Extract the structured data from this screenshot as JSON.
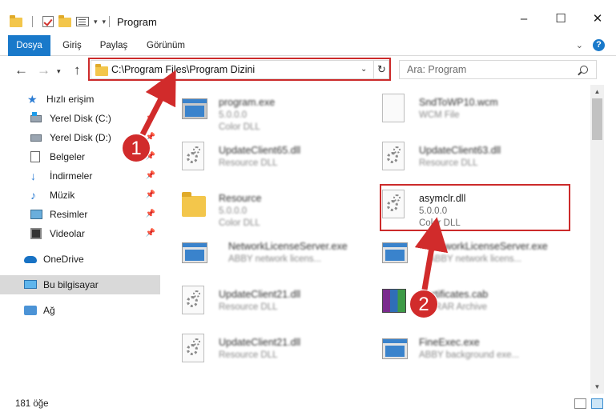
{
  "window": {
    "title": "Program",
    "minimize": "–",
    "maximize": "☐",
    "close": "✕"
  },
  "ribbon": {
    "tabs": [
      "Dosya",
      "Giriş",
      "Paylaş",
      "Görünüm"
    ],
    "help": "?"
  },
  "nav": {
    "address": "C:\\Program Files\\Program Dizini",
    "search_placeholder": "Ara: Program"
  },
  "sidebar": {
    "items": [
      {
        "label": "Hızlı erişim",
        "icon": "star-icon"
      },
      {
        "label": "Yerel Disk (C:)",
        "icon": "disk-c-icon"
      },
      {
        "label": "Yerel Disk (D:)",
        "icon": "disk-d-icon"
      },
      {
        "label": "Belgeler",
        "icon": "documents-icon"
      },
      {
        "label": "İndirmeler",
        "icon": "downloads-icon"
      },
      {
        "label": "Müzik",
        "icon": "music-icon"
      },
      {
        "label": "Resimler",
        "icon": "pictures-icon"
      },
      {
        "label": "Videolar",
        "icon": "videos-icon"
      },
      {
        "label": "OneDrive",
        "icon": "onedrive-icon"
      },
      {
        "label": "Bu bilgisayar",
        "icon": "this-pc-icon"
      },
      {
        "label": "Ağ",
        "icon": "network-icon"
      }
    ]
  },
  "files": [
    {
      "name": "program.exe",
      "line2": "5.0.0.0",
      "line3": "Color DLL",
      "icon": "exe-icon"
    },
    {
      "name": "SndToWP10.wcm",
      "line2": "WCM File",
      "line3": "",
      "icon": "page-icon"
    },
    {
      "name": "UpdateClient65.dll",
      "line2": "Resource DLL",
      "line3": "",
      "icon": "dll-icon"
    },
    {
      "name": "UpdateClient63.dll",
      "line2": "Resource DLL",
      "line3": "",
      "icon": "dll-icon"
    },
    {
      "name": "Resource",
      "line2": "5.0.0.0",
      "line3": "Color DLL",
      "icon": "folder-icon"
    },
    {
      "name": "asymclr.dll",
      "line2": "5.0.0.0",
      "line3": "Color DLL",
      "icon": "dll-icon"
    },
    {
      "name": "NetworkLicenseServer.exe",
      "line2": "ABBY network licens...",
      "line3": "",
      "icon": "exe-icon"
    },
    {
      "name": "NetworkLicenseServer.exe",
      "line2": "ABBY network licens...",
      "line3": "",
      "icon": "exe-icon"
    },
    {
      "name": "UpdateClient21.dll",
      "line2": "Resource DLL",
      "line3": "",
      "icon": "dll-icon"
    },
    {
      "name": "Certificates.cab",
      "line2": "WinRAR Archive",
      "line3": "",
      "icon": "rar-icon"
    },
    {
      "name": "UpdateClient21.dll",
      "line2": "Resource DLL",
      "line3": "",
      "icon": "dll-icon"
    },
    {
      "name": "FineExec.exe",
      "line2": "ABBY background exe...",
      "line3": "",
      "icon": "exe-icon"
    }
  ],
  "status": {
    "count": "181 öğe"
  },
  "callouts": {
    "one": "1",
    "two": "2"
  },
  "colors": {
    "accent": "#1979ca",
    "highlight": "#cc2b2b"
  }
}
